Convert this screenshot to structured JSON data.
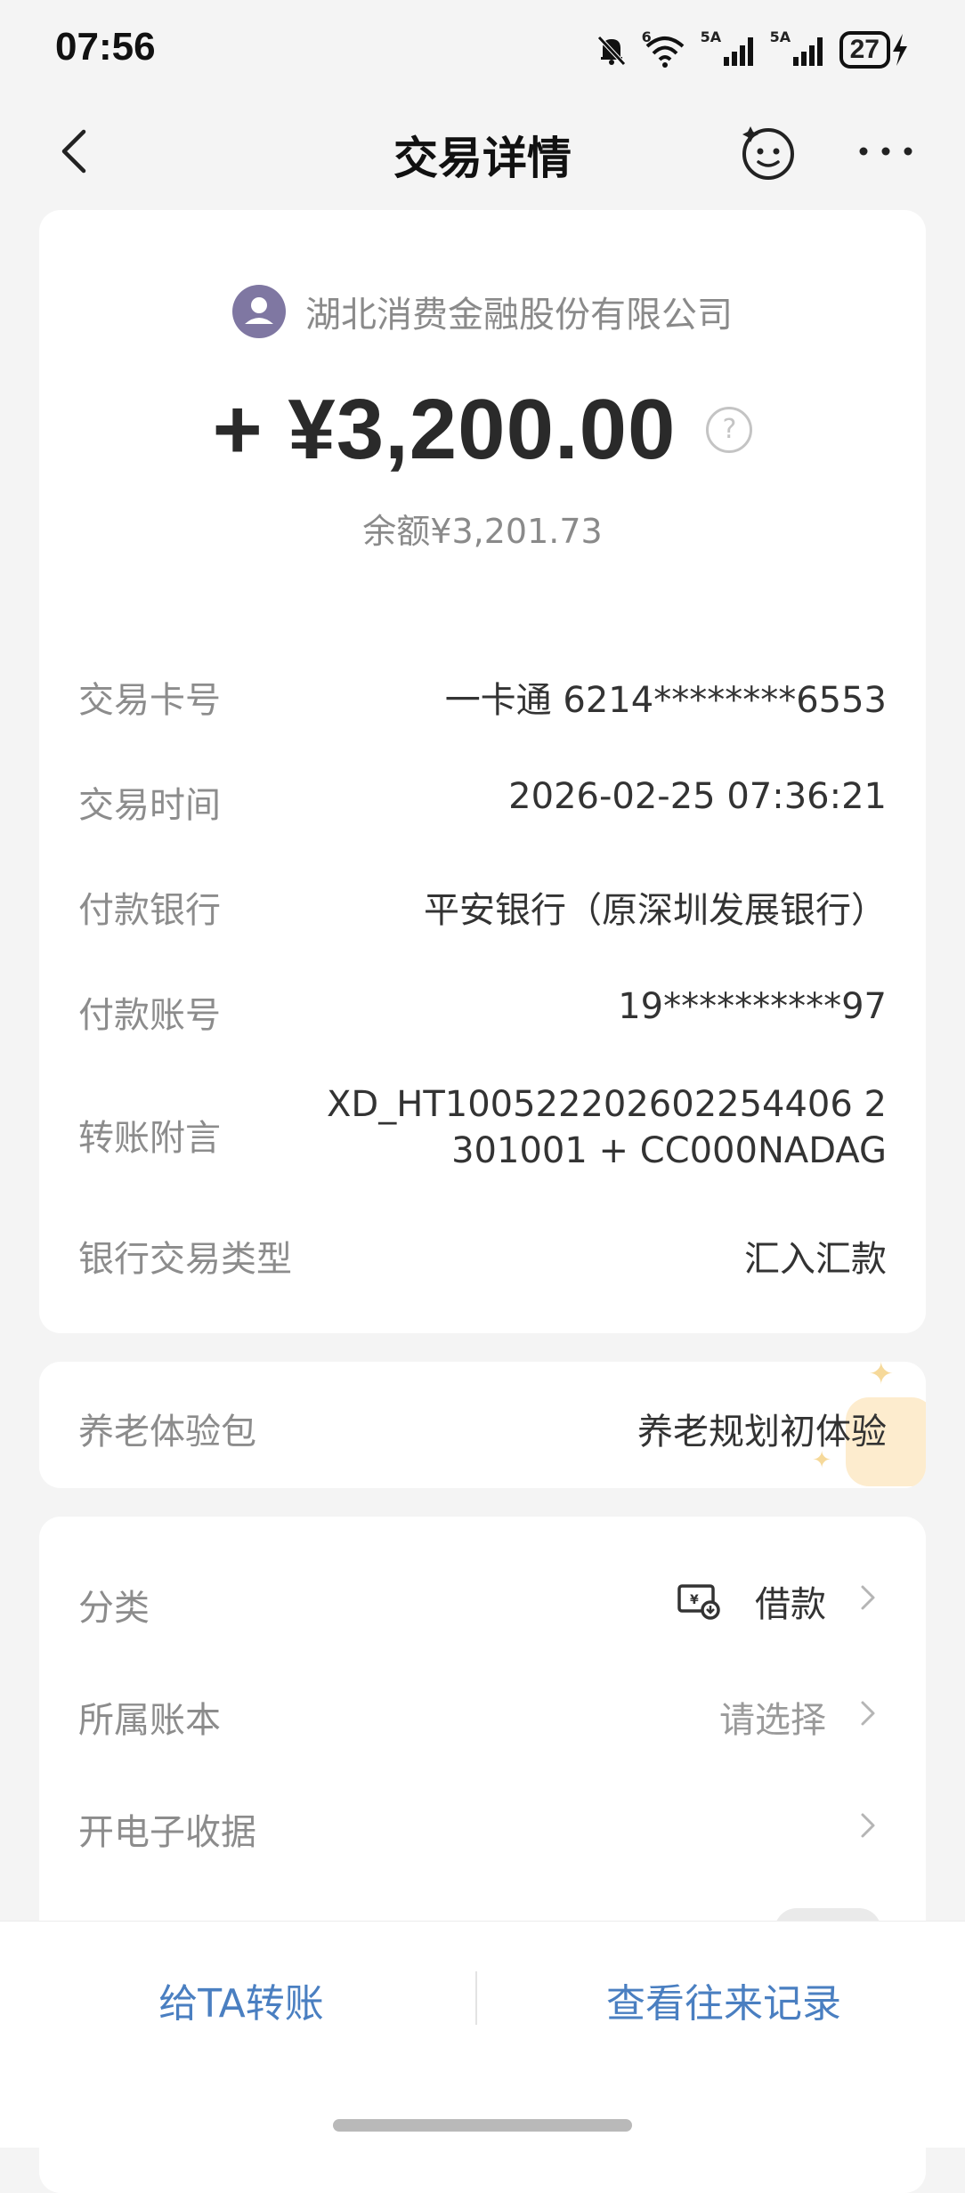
{
  "status_bar": {
    "time": "07:56",
    "wifi_label": "6",
    "sim1_label": "5A",
    "sim2_label": "5A",
    "battery": "27",
    "icons": [
      "bell-muted-icon",
      "wifi-icon",
      "signal-icon",
      "signal-icon",
      "battery-icon",
      "charging-icon"
    ]
  },
  "nav": {
    "title": "交易详情",
    "back_icon": "chevron-left-icon",
    "face_icon": "smiley-face-icon",
    "more_icon": "more-dots-icon"
  },
  "transaction": {
    "payer": "湖北消费金融股份有限公司",
    "amount": "+ ¥3,200.00",
    "balance": "余额¥3,201.73"
  },
  "details": [
    {
      "label": "交易卡号",
      "value": "一卡通 6214********6553"
    },
    {
      "label": "交易时间",
      "value": "2026-02-25 07:36:21"
    },
    {
      "label": "付款银行",
      "value": "平安银行（原深圳发展银行）"
    },
    {
      "label": "付款账号",
      "value": "19**********97"
    },
    {
      "label": "转账附言",
      "value_line1": "XD_HT100522202602254406 2",
      "value_line2": "301001 + CC000NADAG"
    },
    {
      "label": "银行交易类型",
      "value": "汇入汇款"
    }
  ],
  "pension": {
    "label": "养老体验包",
    "value": "养老规划初体验"
  },
  "settings": {
    "category_label": "分类",
    "category_value": "借款",
    "account_book_label": "所属账本",
    "account_book_value": "请选择",
    "receipt_label": "开电子收据"
  },
  "bottom": {
    "transfer_label": "给TA转账",
    "history_label": "查看往来记录"
  },
  "colors": {
    "accent_blue": "#4a7fc1",
    "avatar_purple": "#7f77a2",
    "background": "#f4f4f4"
  }
}
